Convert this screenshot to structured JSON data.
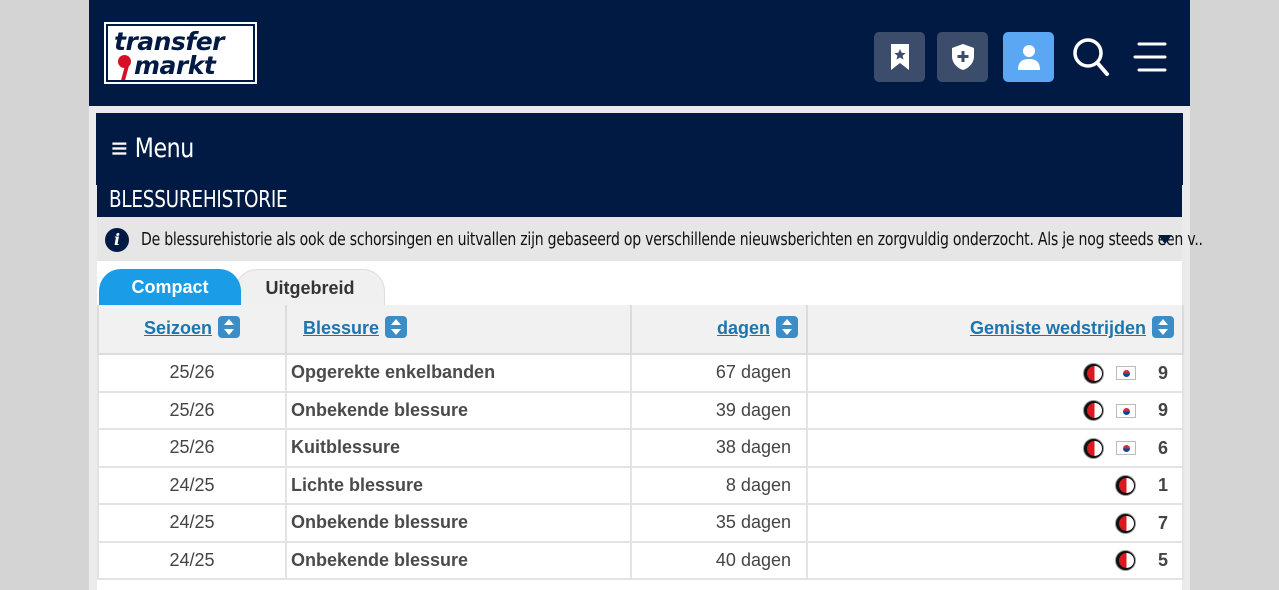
{
  "header": {
    "logo_line1": "transfer",
    "logo_line2": "markt",
    "buttons": [
      {
        "icon": "bookmark-star-icon"
      },
      {
        "icon": "shield-plus-icon"
      },
      {
        "icon": "user-icon"
      },
      {
        "icon": "search-icon"
      },
      {
        "icon": "hamburger-menu-icon"
      }
    ]
  },
  "menu": {
    "label": "≡ Menu"
  },
  "section": {
    "title": "BLESSUREHISTORIE",
    "info_text": "De blessurehistorie als ook de schorsingen en uitvallen zijn gebaseerd op verschillende nieuwsberichten en zorgvuldig onderzocht. Als je nog steeds een v.."
  },
  "tabs": [
    {
      "label": "Compact",
      "active": true
    },
    {
      "label": "Uitgebreid",
      "active": false
    }
  ],
  "table": {
    "headers": [
      "Seizoen",
      "Blessure",
      "dagen",
      "Gemiste wedstrijden"
    ],
    "rows": [
      {
        "season": "25/26",
        "injury": "Opgerekte enkelbanden",
        "days": "67 dagen",
        "club": true,
        "flag": true,
        "missed": "9"
      },
      {
        "season": "25/26",
        "injury": "Onbekende blessure",
        "days": "39 dagen",
        "club": true,
        "flag": true,
        "missed": "9"
      },
      {
        "season": "25/26",
        "injury": "Kuitblessure",
        "days": "38 dagen",
        "club": true,
        "flag": true,
        "missed": "6"
      },
      {
        "season": "24/25",
        "injury": "Lichte blessure",
        "days": "8 dagen",
        "club": true,
        "flag": false,
        "missed": "1"
      },
      {
        "season": "24/25",
        "injury": "Onbekende blessure",
        "days": "35 dagen",
        "club": true,
        "flag": false,
        "missed": "7"
      },
      {
        "season": "24/25",
        "injury": "Onbekende blessure",
        "days": "40 dagen",
        "club": true,
        "flag": false,
        "missed": "5"
      }
    ]
  },
  "colors": {
    "navy": "#011a44",
    "accent_blue": "#1a9ce7",
    "link_blue": "#1c75ac",
    "active_user_button": "#5ba7f4"
  }
}
